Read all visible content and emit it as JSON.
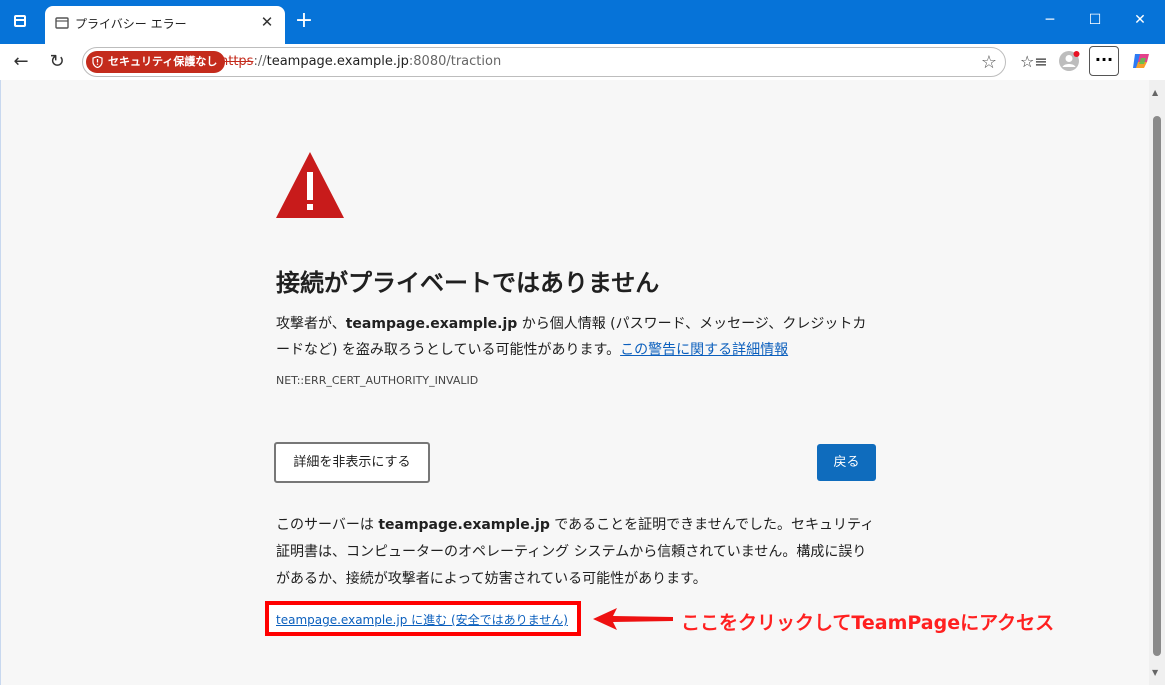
{
  "tab": {
    "title": "プライバシー エラー",
    "close": "✕"
  },
  "newtab": "+",
  "window": {
    "minimize": "─",
    "maximize": "☐",
    "close": "✕"
  },
  "toolbar": {
    "back": "←",
    "reload": "↻",
    "security_label": "セキュリティ保護なし",
    "url_scheme": "https",
    "url_sep": "://",
    "url_host": "teampage.example.jp",
    "url_path": ":8080/traction",
    "favorite": "☆",
    "favorites_list": "☆≡",
    "more": "···"
  },
  "page": {
    "heading": "接続がプライベートではありません",
    "p1_a": "攻撃者が、",
    "p1_host": "teampage.example.jp",
    "p1_b": " から個人情報 (パスワード、メッセージ、クレジットカードなど) を盗み取ろうとしている可能性があります。",
    "p1_link": "この警告に関する詳細情報",
    "error_code": "NET::ERR_CERT_AUTHORITY_INVALID",
    "hide_details": "詳細を非表示にする",
    "back": "戻る",
    "p2_a": "このサーバーは ",
    "p2_host": "teampage.example.jp",
    "p2_b": " であることを証明できませんでした。セキュリティ証明書は、コンピューターのオペレーティング システムから信頼されていません。構成に誤りがあるか、接続が攻撃者によって妨害されている可能性があります。",
    "proceed_link": "teampage.example.jp に進む (安全ではありません)"
  },
  "annotation": {
    "text": "ここをクリックしてTeamPageにアクセス",
    "color": "#ff2020"
  },
  "colors": {
    "accent": "#0f6cbd",
    "danger": "#c42b1c",
    "titlebar": "#0673d8"
  }
}
